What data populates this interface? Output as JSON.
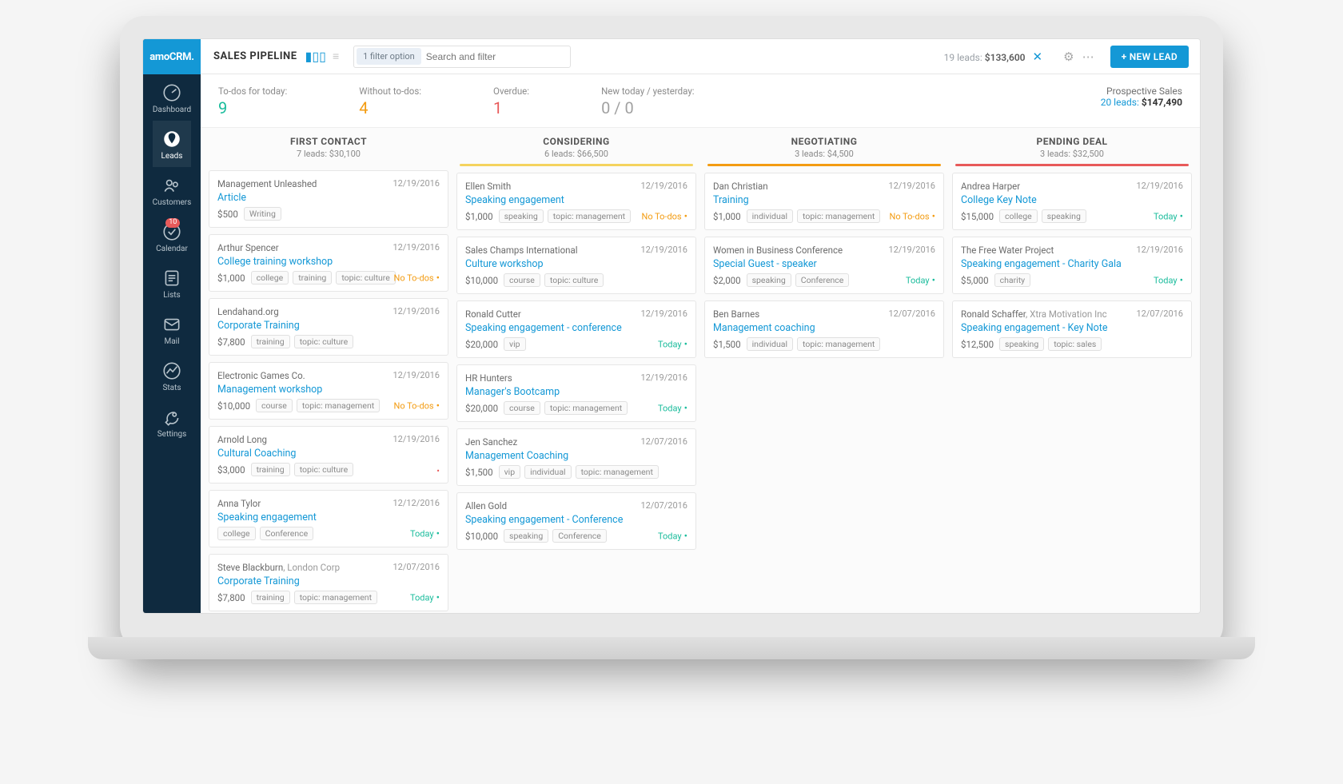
{
  "brand": "amoCRM.",
  "sidebar": {
    "items": [
      {
        "id": "dashboard",
        "label": "Dashboard",
        "active": false,
        "badge": null
      },
      {
        "id": "leads",
        "label": "Leads",
        "active": true,
        "badge": null
      },
      {
        "id": "customers",
        "label": "Customers",
        "active": false,
        "badge": null
      },
      {
        "id": "calendar",
        "label": "Calendar",
        "active": false,
        "badge": "10"
      },
      {
        "id": "lists",
        "label": "Lists",
        "active": false,
        "badge": null
      },
      {
        "id": "mail",
        "label": "Mail",
        "active": false,
        "badge": null
      },
      {
        "id": "stats",
        "label": "Stats",
        "active": false,
        "badge": null
      },
      {
        "id": "settings",
        "label": "Settings",
        "active": false,
        "badge": null
      }
    ]
  },
  "header": {
    "title": "SALES PIPELINE",
    "filter_pill": "1 filter option",
    "search_placeholder": "Search and filter",
    "summary_leads_label": "19 leads:",
    "summary_leads_value": "$133,600",
    "new_lead_btn": "+ NEW LEAD"
  },
  "stats": {
    "todos": {
      "label": "To-dos for today:",
      "value": "9",
      "color": "green"
    },
    "without": {
      "label": "Without to-dos:",
      "value": "4",
      "color": "orange"
    },
    "overdue": {
      "label": "Overdue:",
      "value": "1",
      "color": "red"
    },
    "newtoday": {
      "label": "New today / yesterday:",
      "value": "0 / 0",
      "color": "gray"
    },
    "prospective": {
      "label": "Prospective Sales",
      "leads": "20 leads:",
      "value": "$147,490"
    }
  },
  "columns": [
    {
      "name": "FIRST CONTACT",
      "sub": "7 leads: $30,100",
      "cards": [
        {
          "contact": "Management Unleashed",
          "company": "",
          "date": "12/19/2016",
          "title": "Article",
          "price": "$500",
          "tags": [
            "Writing"
          ],
          "status": ""
        },
        {
          "contact": "Arthur Spencer",
          "company": "",
          "date": "12/19/2016",
          "title": "College training workshop",
          "price": "$1,000",
          "tags": [
            "college",
            "training",
            "topic: culture"
          ],
          "status": "No To-dos",
          "stype": "no"
        },
        {
          "contact": "Lendahand.org",
          "company": "",
          "date": "12/19/2016",
          "title": "Corporate Training",
          "price": "$7,800",
          "tags": [
            "training",
            "topic: culture"
          ],
          "status": ""
        },
        {
          "contact": "Electronic Games Co.",
          "company": "",
          "date": "12/19/2016",
          "title": "Management workshop",
          "price": "$10,000",
          "tags": [
            "course",
            "topic: management"
          ],
          "status": "No To-dos",
          "stype": "no"
        },
        {
          "contact": "Arnold Long",
          "company": "",
          "date": "12/19/2016",
          "title": "Cultural Coaching",
          "price": "$3,000",
          "tags": [
            "training",
            "topic: culture"
          ],
          "status": "",
          "stype": "reddot"
        },
        {
          "contact": "Anna Tylor",
          "company": "",
          "date": "12/12/2016",
          "title": "Speaking engagement",
          "price": "",
          "tags": [
            "college",
            "Conference"
          ],
          "status": "Today",
          "stype": "today"
        },
        {
          "contact": "Steve Blackburn",
          "company": "London Corp",
          "date": "12/07/2016",
          "title": "Corporate Training",
          "price": "$7,800",
          "tags": [
            "training",
            "topic: management"
          ],
          "status": "Today",
          "stype": "today"
        }
      ]
    },
    {
      "name": "CONSIDERING",
      "sub": "6 leads: $66,500",
      "cards": [
        {
          "contact": "Ellen Smith",
          "company": "",
          "date": "12/19/2016",
          "title": "Speaking engagement",
          "price": "$1,000",
          "tags": [
            "speaking",
            "topic: management"
          ],
          "status": "No To-dos",
          "stype": "no"
        },
        {
          "contact": "Sales Champs International",
          "company": "",
          "date": "12/19/2016",
          "title": "Culture workshop",
          "price": "$10,000",
          "tags": [
            "course",
            "topic: culture"
          ],
          "status": ""
        },
        {
          "contact": "Ronald Cutter",
          "company": "",
          "date": "12/19/2016",
          "title": "Speaking engagement - conference",
          "price": "$20,000",
          "tags": [
            "vip"
          ],
          "status": "Today",
          "stype": "today"
        },
        {
          "contact": "HR Hunters",
          "company": "",
          "date": "12/19/2016",
          "title": "Manager's Bootcamp",
          "price": "$20,000",
          "tags": [
            "course",
            "topic: management"
          ],
          "status": "Today",
          "stype": "today"
        },
        {
          "contact": "Jen Sanchez",
          "company": "",
          "date": "12/07/2016",
          "title": "Management Coaching",
          "price": "$1,500",
          "tags": [
            "vip",
            "individual",
            "topic: management"
          ],
          "status": ""
        },
        {
          "contact": "Allen Gold",
          "company": "",
          "date": "12/07/2016",
          "title": "Speaking engagement - Conference",
          "price": "$10,000",
          "tags": [
            "speaking",
            "Conference"
          ],
          "status": "Today",
          "stype": "today"
        }
      ]
    },
    {
      "name": "NEGOTIATING",
      "sub": "3 leads: $4,500",
      "cards": [
        {
          "contact": "Dan Christian",
          "company": "",
          "date": "12/19/2016",
          "title": "Training",
          "price": "$1,000",
          "tags": [
            "individual",
            "topic: management"
          ],
          "status": "No To-dos",
          "stype": "no"
        },
        {
          "contact": "Women in Business Conference",
          "company": "",
          "date": "12/19/2016",
          "title": "Special Guest - speaker",
          "price": "$2,000",
          "tags": [
            "speaking",
            "Conference"
          ],
          "status": "Today",
          "stype": "today"
        },
        {
          "contact": "Ben Barnes",
          "company": "",
          "date": "12/07/2016",
          "title": "Management coaching",
          "price": "$1,500",
          "tags": [
            "individual",
            "topic: management"
          ],
          "status": ""
        }
      ]
    },
    {
      "name": "PENDING DEAL",
      "sub": "3 leads: $32,500",
      "cards": [
        {
          "contact": "Andrea Harper",
          "company": "",
          "date": "12/19/2016",
          "title": "College Key Note",
          "price": "$15,000",
          "tags": [
            "college",
            "speaking"
          ],
          "status": "Today",
          "stype": "today"
        },
        {
          "contact": "The Free Water Project",
          "company": "",
          "date": "12/19/2016",
          "title": "Speaking engagement - Charity Gala",
          "price": "$5,000",
          "tags": [
            "charity"
          ],
          "status": "Today",
          "stype": "today"
        },
        {
          "contact": "Ronald Schaffer",
          "company": "Xtra Motivation Inc",
          "date": "12/07/2016",
          "title": "Speaking engagement - Key Note",
          "price": "$12,500",
          "tags": [
            "speaking",
            "topic: sales"
          ],
          "status": ""
        }
      ]
    }
  ]
}
